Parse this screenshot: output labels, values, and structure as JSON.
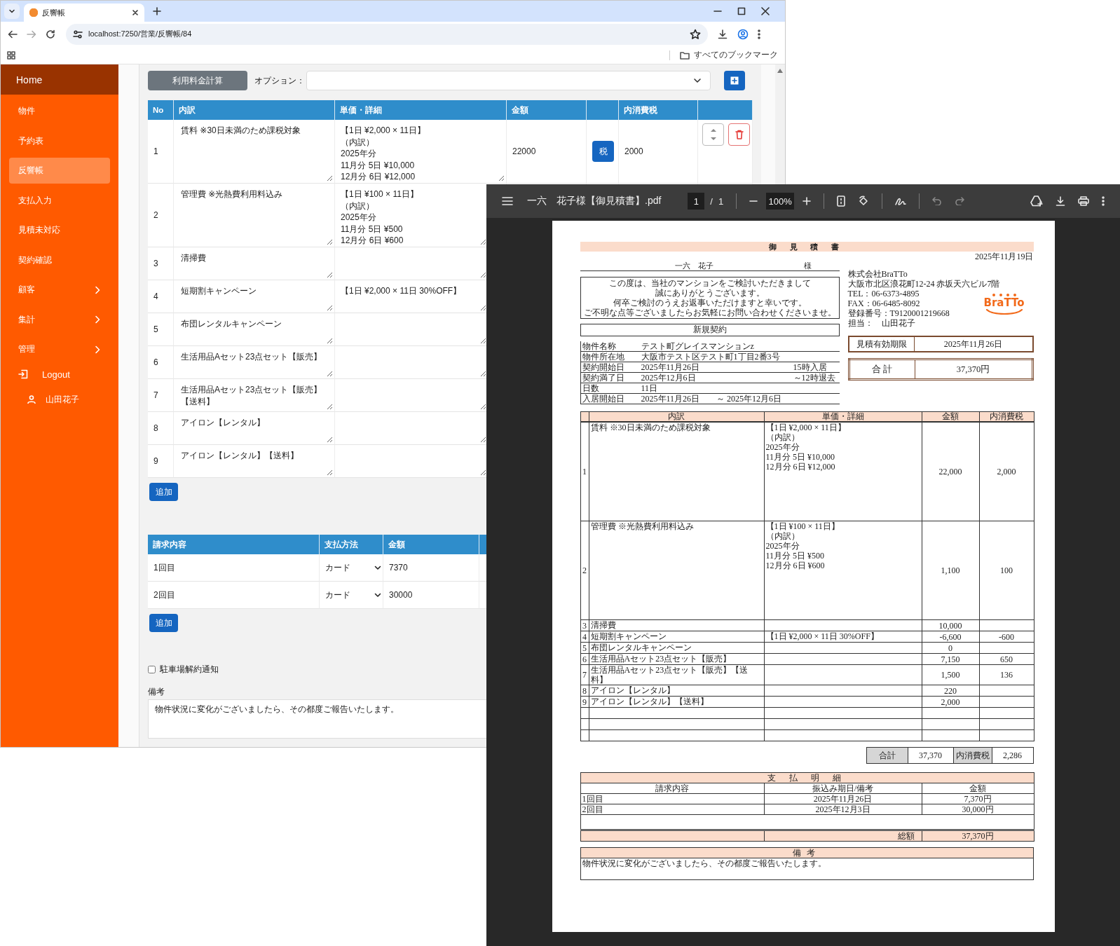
{
  "browser": {
    "tab_title": "反響帳",
    "url": "localhost:7250/営業/反響帳/84",
    "bookmarks_label": "すべてのブックマーク"
  },
  "sidebar": {
    "home": "Home",
    "items": [
      {
        "label": "物件",
        "selected": false,
        "expandable": false
      },
      {
        "label": "予約表",
        "selected": false,
        "expandable": false
      },
      {
        "label": "反響帳",
        "selected": true,
        "expandable": false
      },
      {
        "label": "支払入力",
        "selected": false,
        "expandable": false
      },
      {
        "label": "見積未対応",
        "selected": false,
        "expandable": false
      },
      {
        "label": "契約確認",
        "selected": false,
        "expandable": false
      },
      {
        "label": "顧客",
        "selected": false,
        "expandable": true
      },
      {
        "label": "集計",
        "selected": false,
        "expandable": true
      },
      {
        "label": "管理",
        "selected": false,
        "expandable": true
      }
    ],
    "logout": "Logout",
    "user": "山田花子"
  },
  "toolbar": {
    "calc_button": "利用料金計算",
    "option_label": "オプション："
  },
  "items_table": {
    "columns": [
      "No",
      "内訳",
      "単価・詳細",
      "金額",
      "内消費税"
    ],
    "rows": [
      {
        "no": "1",
        "item": "賃料 ※30日未満のため課税対象",
        "detail": [
          "【1日 ¥2,000 × 11日】",
          "（内訳）",
          "2025年分",
          "11月分 5日 ¥10,000",
          "12月分 6日 ¥12,000"
        ],
        "amount": "22000",
        "tax_button": "税",
        "tax": "2000"
      },
      {
        "no": "2",
        "item": "管理費 ※光熱費利用料込み",
        "detail": [
          "【1日 ¥100 × 11日】",
          "（内訳）",
          "2025年分",
          "11月分 5日 ¥500",
          "12月分 6日 ¥600"
        ]
      },
      {
        "no": "3",
        "item": "清掃費"
      },
      {
        "no": "4",
        "item": "短期割キャンペーン",
        "detail": [
          "【1日 ¥2,000 × 11日 30%OFF】"
        ]
      },
      {
        "no": "5",
        "item": "布団レンタルキャンペーン"
      },
      {
        "no": "6",
        "item": "生活用品Aセット23点セット【販売】"
      },
      {
        "no": "7",
        "item": "生活用品Aセット23点セット【販売】【送料】"
      },
      {
        "no": "8",
        "item": "アイロン【レンタル】"
      },
      {
        "no": "9",
        "item": "アイロン【レンタル】【送料】"
      }
    ],
    "add_button": "追加"
  },
  "payments": {
    "columns": [
      "請求内容",
      "支払方法",
      "金額"
    ],
    "rows": [
      {
        "label": "1回目",
        "method": "カード",
        "amount": "7370"
      },
      {
        "label": "2回目",
        "method": "カード",
        "amount": "30000"
      }
    ],
    "add_button": "追加"
  },
  "parking_notice": {
    "label": "駐車場解約通知",
    "checked": false
  },
  "remarks": {
    "label": "備考",
    "value": "物件状況に変化がございましたら、その都度ご報告いたします。"
  },
  "pdf_viewer": {
    "title": "一六　花子様【御見積書】.pdf",
    "page": "1",
    "page_separator": "/",
    "page_count": "1",
    "zoom": "100%"
  },
  "document": {
    "title": "御 見 積 書",
    "date": "2025年11月19日",
    "customer": "一六　花子",
    "honorific": "様",
    "greeting": [
      "この度は、当社のマンションをご検討いただきまして",
      "誠にありがとうございます。",
      "何卒ご検討のうえお返事いただけますと幸いです。",
      "ご不明な点等ございましたらお気軽にお問い合わせくださいませ。"
    ],
    "contract_type": "新規契約",
    "property": [
      {
        "label": "物件名称",
        "value": "テスト町グレイスマンションz"
      },
      {
        "label": "物件所在地",
        "value": "大阪市テスト区テスト町1丁目2番3号"
      },
      {
        "label": "契約開始日",
        "value": "2025年11月26日",
        "note": "15時入居"
      },
      {
        "label": "契約満了日",
        "value": "2025年12月6日",
        "note": "～12時退去"
      },
      {
        "label": "日数",
        "value": "11日"
      },
      {
        "label": "入居開始日",
        "value": "2025年11月26日　　～ 2025年12月6日"
      }
    ],
    "company": [
      "株式会社BraTTo",
      "大阪市北区浪花町12-24 赤坂天六ビル7階",
      "TEL：06-6373-4895",
      "FAX：06-6485-8092",
      "登録番号：T9120001219668",
      "担当：　山田花子"
    ],
    "logo_text": "BraTTo",
    "validity": {
      "label": "見積有効期限",
      "value": "2025年11月26日"
    },
    "total_box": {
      "label": "合 計",
      "value": "37,370円"
    },
    "lines": {
      "columns": [
        "内訳",
        "単価・詳細",
        "金額",
        "内消費税"
      ],
      "rows": [
        {
          "no": "1",
          "item": "賃料 ※30日未満のため課税対象",
          "detail": [
            "【1日 ¥2,000 × 11日】",
            "（内訳）",
            "2025年分",
            "11月分 5日 ¥10,000",
            "12月分 6日 ¥12,000"
          ],
          "amount": "22,000",
          "tax": "2,000"
        },
        {
          "no": "2",
          "item": "管理費 ※光熱費利用料込み",
          "detail": [
            "【1日 ¥100 × 11日】",
            "（内訳）",
            "2025年分",
            "11月分 5日 ¥500",
            "12月分 6日 ¥600"
          ],
          "amount": "1,100",
          "tax": "100"
        },
        {
          "no": "3",
          "item": "清掃費",
          "amount": "10,000"
        },
        {
          "no": "4",
          "item": "短期割キャンペーン",
          "detail": [
            "【1日 ¥2,000 × 11日 30%OFF】"
          ],
          "amount": "-6,600",
          "tax": "-600"
        },
        {
          "no": "5",
          "item": "布団レンタルキャンペーン",
          "amount": "0"
        },
        {
          "no": "6",
          "item": "生活用品Aセット23点セット【販売】",
          "amount": "7,150",
          "tax": "650"
        },
        {
          "no": "7",
          "item": "生活用品Aセット23点セット【販売】【送料】",
          "amount": "1,500",
          "tax": "136"
        },
        {
          "no": "8",
          "item": "アイロン【レンタル】",
          "amount": "220"
        },
        {
          "no": "9",
          "item": "アイロン【レンタル】【送料】",
          "amount": "2,000"
        }
      ]
    },
    "summary": {
      "total_label": "合計",
      "total": "37,370",
      "tax_label": "内消費税",
      "tax": "2,286"
    },
    "payments": {
      "title": "支 払 明 細",
      "columns": [
        "請求内容",
        "振込み期日/備考",
        "金額"
      ],
      "rows": [
        {
          "label": "1回目",
          "date": "2025年11月26日",
          "amount": "7,370円"
        },
        {
          "label": "2回目",
          "date": "2025年12月3日",
          "amount": "30,000円"
        }
      ],
      "total_label": "総額",
      "total": "37,370円"
    },
    "remarks": {
      "title": "備考",
      "text": "物件状況に変化がございましたら、その都度ご報告いたします。"
    }
  }
}
